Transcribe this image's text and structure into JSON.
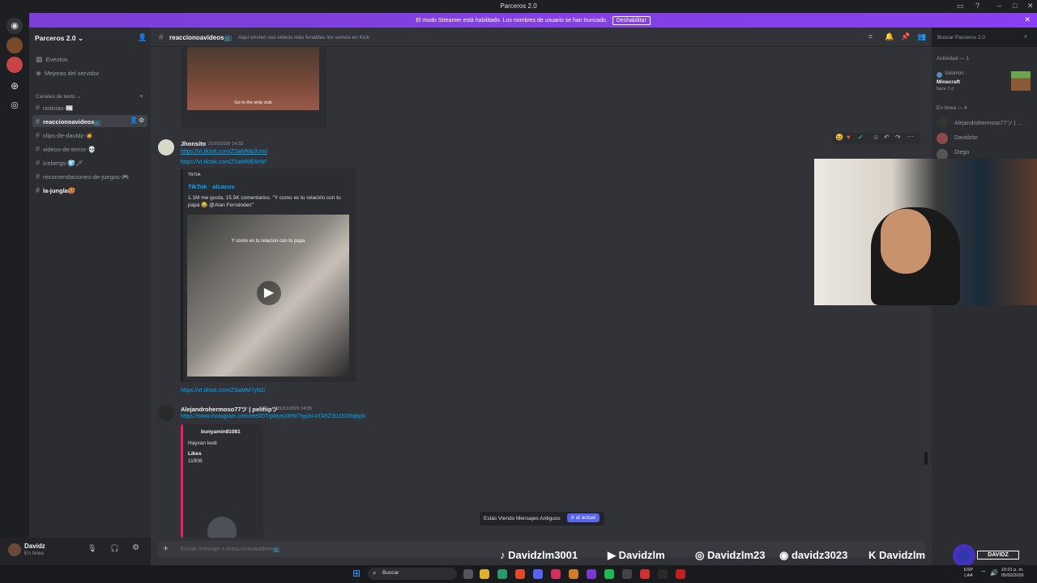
{
  "window": {
    "title": "Parceros 2.0"
  },
  "banner": {
    "text": "El modo Streamer está habilitado. Los nombres de usuario se han truncado.",
    "button": "Deshabilitar"
  },
  "server": {
    "name": "Parceros 2.0"
  },
  "sidebar": {
    "top_items": [
      {
        "label": "Eventos"
      },
      {
        "label": "Mejoras del servidor"
      }
    ],
    "category": "Canales de texto",
    "channels": [
      {
        "label": "noticias-📰"
      },
      {
        "label": "reaccionoavideos📺"
      },
      {
        "label": "clips-de-davidz-🧔"
      },
      {
        "label": "videos-de-terror-💀"
      },
      {
        "label": "icebergs-🧊🗡"
      },
      {
        "label": "recomendaciones-de-juegos-🎮"
      },
      {
        "label": "la-jungla🥵"
      }
    ]
  },
  "user": {
    "name": "Davidz",
    "status": "En línea"
  },
  "header": {
    "channel": "reaccionoavideos📺",
    "topic": "Aquí envíen sus videos más funables los vemos en Kick",
    "search_placeholder": "Buscar Parceros 2.0"
  },
  "messages": {
    "top_embed_caption": "Go to the strip club",
    "msg1": {
      "author": "Jhonsito",
      "timestamp": "21/01/2026 14:33",
      "links": [
        "https://vt.tiktok.com/ZSaMMp3Um/",
        "https://vt.tiktok.com/ZSaMME6rW/"
      ],
      "embed": {
        "provider": "TikTok",
        "title": "TikTok · alcacos",
        "description": "1.1M me gusta, 15.5K comentarios. \"Y como es tu relación con tu papá 😂 @Alan Fernández\"",
        "video_caption": "Y como es tu relacion con tu papa"
      },
      "link3": "https://vt.tiktok.com/ZSaMM7yN2/"
    },
    "msg2": {
      "author": "Alejandrohermoso77ツ | pelifiipツ",
      "timestamp": "21/01/2026 14:55",
      "link": "https://www.instagram.com/reel/DTqWyejXRN/?igsh=aTA5Z3I1OGRqbjdv",
      "embed": {
        "author": "bunyamin81081",
        "description": "Hayvan kedi",
        "field_name": "Likes",
        "field_value": "11908"
      }
    }
  },
  "jump_bar": {
    "text": "Estás Viendo Mensajes Antiguos",
    "button": "Ir al actual"
  },
  "composer": {
    "placeholder": "Enviar mensaje a #reaccionoavideos📺"
  },
  "members": {
    "activity_header": "Actividad — 1",
    "activity": {
      "user": "Salomón",
      "game": "Minecraft",
      "time": "hace 1 d"
    },
    "online_header": "En línea — 4",
    "list": [
      {
        "name": "Alejandrohermoso77ツ | ..."
      },
      {
        "name": "Davidzito"
      },
      {
        "name": "Diego"
      }
    ]
  },
  "socials": [
    {
      "icon": "tiktok-icon",
      "handle": "Davidzlm3001"
    },
    {
      "icon": "youtube-icon",
      "handle": "Davidzlm"
    },
    {
      "icon": "instagram-icon",
      "handle": "Davidzlm23"
    },
    {
      "icon": "discord-icon",
      "handle": "davidz3023"
    },
    {
      "icon": "kick-icon",
      "handle": "Davidzlm"
    }
  ],
  "overlay_logo": "DAVIDZ",
  "taskbar": {
    "search": "Buscar",
    "lang": "ESP",
    "region": "LAA",
    "time": "10:01 p. m.",
    "date": "05/02/2026"
  },
  "colors": {
    "accent": "#5865f2",
    "link": "#00a8fc",
    "banner": "#8a3ff0"
  }
}
